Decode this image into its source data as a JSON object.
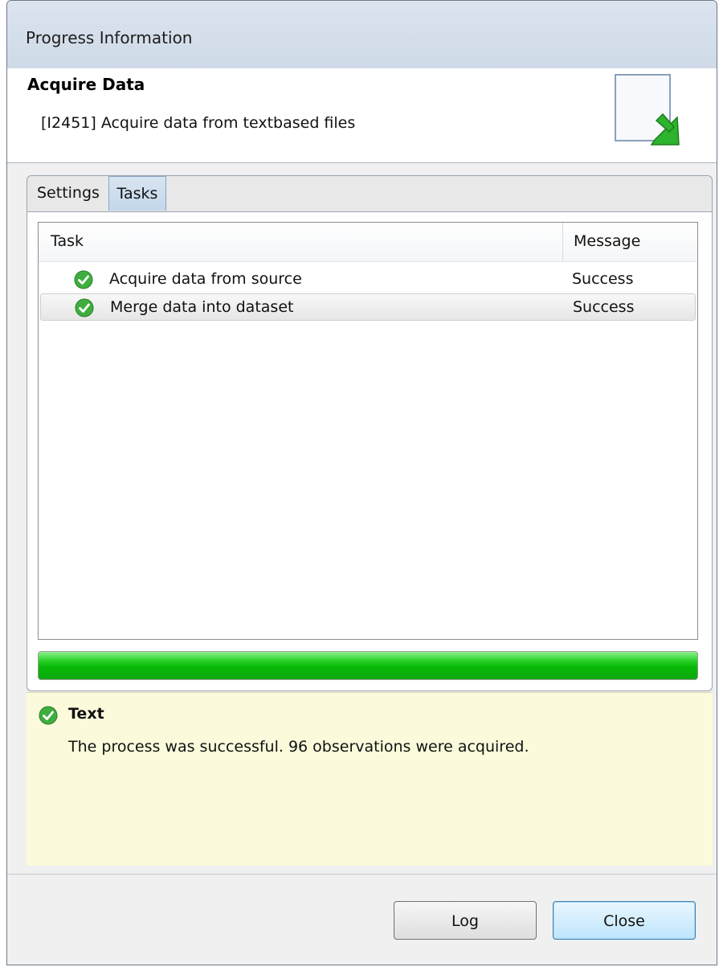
{
  "window": {
    "title": "Progress Information"
  },
  "header": {
    "title": "Acquire Data",
    "description": "[I2451] Acquire data from textbased files",
    "icon": "document-import-icon"
  },
  "tabs": [
    {
      "label": "Settings",
      "selected": false
    },
    {
      "label": "Tasks",
      "selected": true
    }
  ],
  "table": {
    "columns": [
      "Task",
      "Message"
    ],
    "rows": [
      {
        "task": "Acquire data from source",
        "message": "Success",
        "status_icon": "check-circle-icon",
        "selected": false
      },
      {
        "task": "Merge data into dataset",
        "message": "Success",
        "status_icon": "check-circle-icon",
        "selected": true
      }
    ]
  },
  "progress": {
    "fraction": 1.0,
    "color": "#0ab80a"
  },
  "info": {
    "icon": "check-circle-icon",
    "title": "Text",
    "message": "The process was successful. 96 observations were acquired.",
    "background": "#fbfbdc"
  },
  "buttons": {
    "log_label": "Log",
    "close_label": "Close"
  }
}
